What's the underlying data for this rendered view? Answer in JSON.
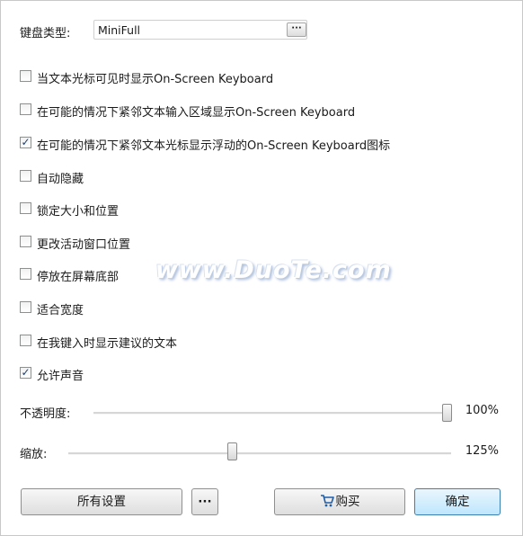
{
  "keyboard": {
    "label": "键盘类型:",
    "value": "MiniFull",
    "more_label": "···"
  },
  "options": [
    {
      "label": "当文本光标可见时显示On-Screen Keyboard",
      "checked": false
    },
    {
      "label": "在可能的情况下紧邻文本输入区域显示On-Screen Keyboard",
      "checked": false
    },
    {
      "label": "在可能的情况下紧邻文本光标显示浮动的On-Screen Keyboard图标",
      "checked": true
    },
    {
      "label": "自动隐藏",
      "checked": false
    },
    {
      "label": "锁定大小和位置",
      "checked": false
    },
    {
      "label": "更改活动窗口位置",
      "checked": false
    },
    {
      "label": "停放在屏幕底部",
      "checked": false
    },
    {
      "label": "适合宽度",
      "checked": false
    },
    {
      "label": "在我键入时显示建议的文本",
      "checked": false
    },
    {
      "label": "允许声音",
      "checked": true
    }
  ],
  "opacity": {
    "label": "不透明度:",
    "value_text": "100%",
    "value": 1.0
  },
  "zoom": {
    "label": "缩放:",
    "value_text": "125%",
    "value": 0.42
  },
  "buttons": {
    "all_settings": "所有设置",
    "more": "···",
    "buy": "购买",
    "ok": "确定"
  },
  "watermark": "www.DuoTe.com",
  "icons": {
    "cart": "cart-icon",
    "check": "check-icon"
  },
  "colors": {
    "check": "#1f3e72",
    "default_button_border": "#3c7fb1"
  }
}
